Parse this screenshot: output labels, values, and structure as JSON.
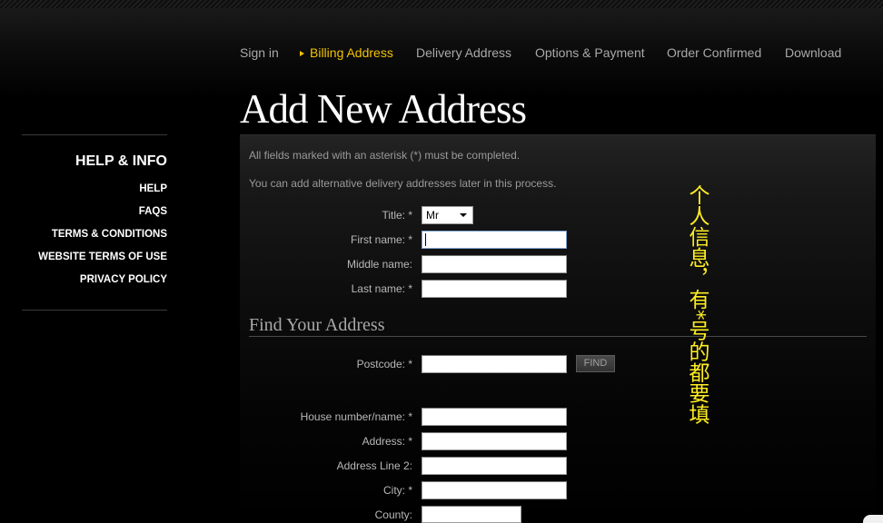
{
  "colors": {
    "nav_active": "#f2c200",
    "nav_inactive": "#a9a9a9",
    "annotation": "#ffee22",
    "title": "#ffffff"
  },
  "icons": {
    "active_step": "triangle-right-icon",
    "select_arrow": "chevron-down-icon"
  },
  "nav": {
    "steps": [
      {
        "label": "Sign in",
        "active": false
      },
      {
        "label": "Billing Address",
        "active": true
      },
      {
        "label": "Delivery Address",
        "active": false
      },
      {
        "label": "Options & Payment",
        "active": false
      },
      {
        "label": "Order Confirmed",
        "active": false
      },
      {
        "label": "Download",
        "active": false
      }
    ]
  },
  "page_title": "Add New Address",
  "sidebar": {
    "heading": "HELP & INFO",
    "links": [
      "HELP",
      "FAQS",
      "TERMS & CONDITIONS",
      "WEBSITE TERMS OF USE",
      "PRIVACY POLICY"
    ]
  },
  "form": {
    "intro_required": "All fields marked with an asterisk (*) must be completed.",
    "intro_alternative": "You can add alternative delivery addresses later in this process.",
    "title": {
      "label": "Title: *",
      "value": "Mr"
    },
    "first_name": {
      "label": "First name: *",
      "value": ""
    },
    "middle_name": {
      "label": "Middle name:",
      "value": ""
    },
    "last_name": {
      "label": "Last name: *",
      "value": ""
    },
    "find_heading": "Find Your Address",
    "postcode": {
      "label": "Postcode: *",
      "value": ""
    },
    "find_button": "FIND",
    "house": {
      "label": "House number/name: *",
      "value": ""
    },
    "address": {
      "label": "Address: *",
      "value": ""
    },
    "address_line_2": {
      "label": "Address Line 2:",
      "value": ""
    },
    "city": {
      "label": "City: *",
      "value": ""
    },
    "county": {
      "label": "County:",
      "value": ""
    }
  },
  "annotation": {
    "text": "个人信息，有*号的都要填"
  }
}
